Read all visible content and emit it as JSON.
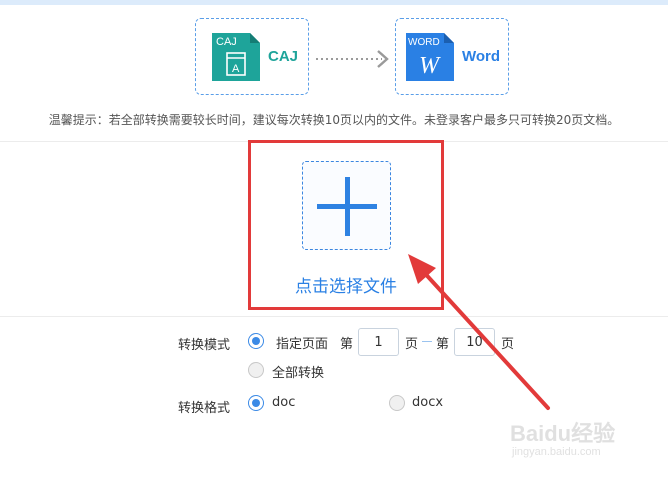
{
  "header": {
    "source": {
      "badge": "CAJ",
      "glyph": "A",
      "label": "CAJ"
    },
    "target": {
      "badge": "WORD",
      "glyph": "W",
      "label": "Word"
    }
  },
  "tip": "温馨提示：若全部转换需要较长时间，建议每次转换10页以内的文件。未登录客户最多只可转换20页文档。",
  "upload": {
    "button_text": "点击选择文件"
  },
  "settings": {
    "mode_label": "转换模式",
    "specified_pages": "指定页面",
    "page_prefix": "第",
    "start_page": "1",
    "page_suffix": "页",
    "end_page": "10",
    "all_pages": "全部转换",
    "format_label": "转换格式",
    "format_doc": "doc",
    "format_docx": "docx",
    "selected_mode": "specified",
    "selected_format": "doc"
  },
  "watermark": {
    "logo": "Baidu经验",
    "url": "jingyan.baidu.com"
  },
  "colors": {
    "caj_green": "#1ea49a",
    "word_blue": "#2a80e4",
    "accent_blue": "#3b8ae6",
    "highlight_red": "#e23a3a"
  }
}
